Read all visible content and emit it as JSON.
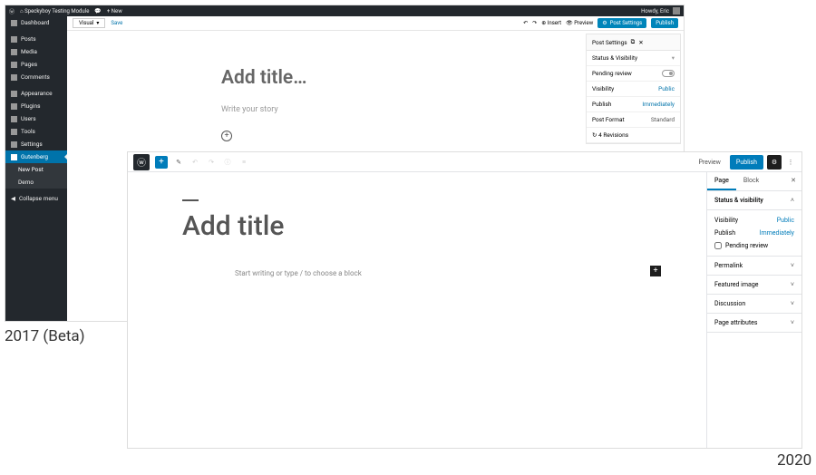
{
  "labels": {
    "y2017": "2017 (Beta)",
    "y2020": "2020"
  },
  "win2017": {
    "adminbar": {
      "site": "Speckyboy Testing Module",
      "comments_icon": "comments-icon",
      "new": "+ New",
      "howdy": "Howdy, Eric"
    },
    "sidebar": {
      "items": [
        {
          "label": "Dashboard",
          "icon": "dashboard-icon"
        },
        {
          "label": "Posts",
          "icon": "pin-icon"
        },
        {
          "label": "Media",
          "icon": "media-icon"
        },
        {
          "label": "Pages",
          "icon": "pages-icon"
        },
        {
          "label": "Comments",
          "icon": "comments-icon"
        },
        {
          "label": "Appearance",
          "icon": "brush-icon"
        },
        {
          "label": "Plugins",
          "icon": "plugin-icon"
        },
        {
          "label": "Users",
          "icon": "users-icon"
        },
        {
          "label": "Tools",
          "icon": "tools-icon"
        },
        {
          "label": "Settings",
          "icon": "settings-icon"
        },
        {
          "label": "Gutenberg",
          "icon": "edit-icon"
        }
      ],
      "sub": [
        {
          "label": "New Post"
        },
        {
          "label": "Demo"
        }
      ],
      "collapse": "Collapse menu"
    },
    "editor_top": {
      "mode": "Visual",
      "save": "Save",
      "undo_icon": "undo-icon",
      "redo_icon": "redo-icon",
      "insert": "Insert",
      "preview": "Preview",
      "post_settings": "Post Settings",
      "publish": "Publish"
    },
    "content": {
      "title_placeholder": "Add title…",
      "body_placeholder": "Write your story"
    },
    "panel": {
      "header": "Post Settings",
      "status_visibility": "Status & Visibility",
      "rows": [
        {
          "label": "Pending review",
          "kind": "toggle"
        },
        {
          "label": "Visibility",
          "value": "Public",
          "link": true
        },
        {
          "label": "Publish",
          "value": "Immediately",
          "link": true
        },
        {
          "label": "Post Format",
          "value": "Standard",
          "link": false
        }
      ],
      "revisions": "4 Revisions"
    }
  },
  "win2020": {
    "toolbar": {
      "add_icon": "plus-icon",
      "edit_icon": "pencil-icon",
      "undo_icon": "undo-icon",
      "redo_icon": "redo-icon",
      "info_icon": "info-icon",
      "list_icon": "outline-icon",
      "preview": "Preview",
      "publish": "Publish",
      "gear_icon": "gear-icon",
      "more_icon": "more-icon"
    },
    "content": {
      "title_placeholder": "Add title",
      "body_placeholder": "Start writing or type / to choose a block"
    },
    "panel": {
      "tabs": {
        "page": "Page",
        "block": "Block"
      },
      "status_visibility": "Status & visibility",
      "rows": [
        {
          "label": "Visibility",
          "value": "Public"
        },
        {
          "label": "Publish",
          "value": "Immediately"
        }
      ],
      "pending": "Pending review",
      "sections": [
        {
          "label": "Permalink"
        },
        {
          "label": "Featured image"
        },
        {
          "label": "Discussion"
        },
        {
          "label": "Page attributes"
        }
      ]
    }
  }
}
